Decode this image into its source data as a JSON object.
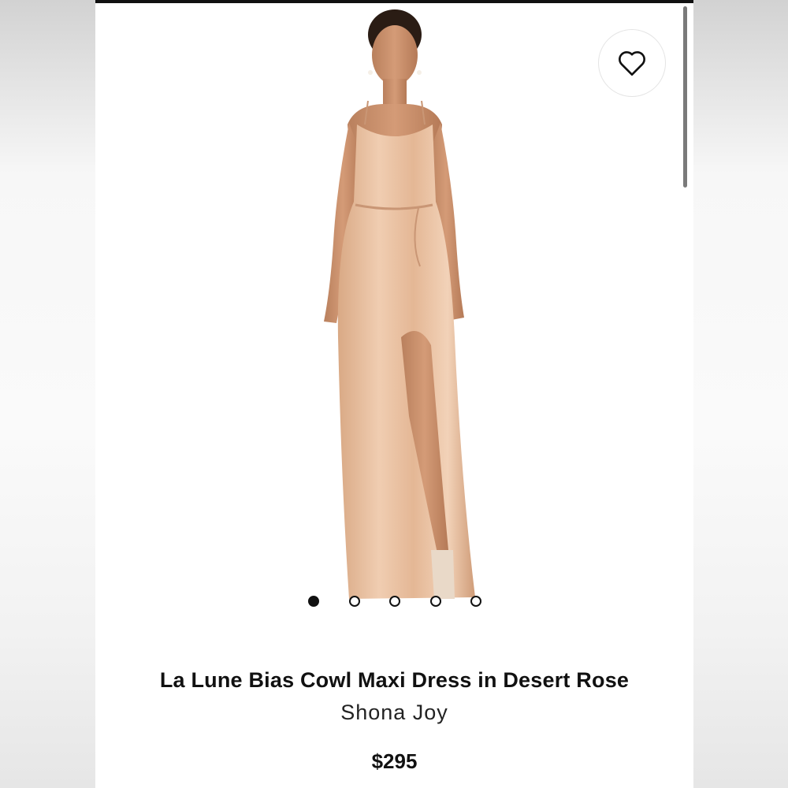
{
  "product": {
    "title": "La Lune Bias Cowl Maxi Dress in Desert Rose",
    "brand": "Shona Joy",
    "price": "$295"
  },
  "gallery": {
    "image_count": 5,
    "active_index": 0
  },
  "icons": {
    "favorite": "heart-outline-icon"
  },
  "colors": {
    "dress": "#e3b898",
    "skin": "#c98f6c",
    "dot_active": "#111111",
    "text": "#111111"
  }
}
